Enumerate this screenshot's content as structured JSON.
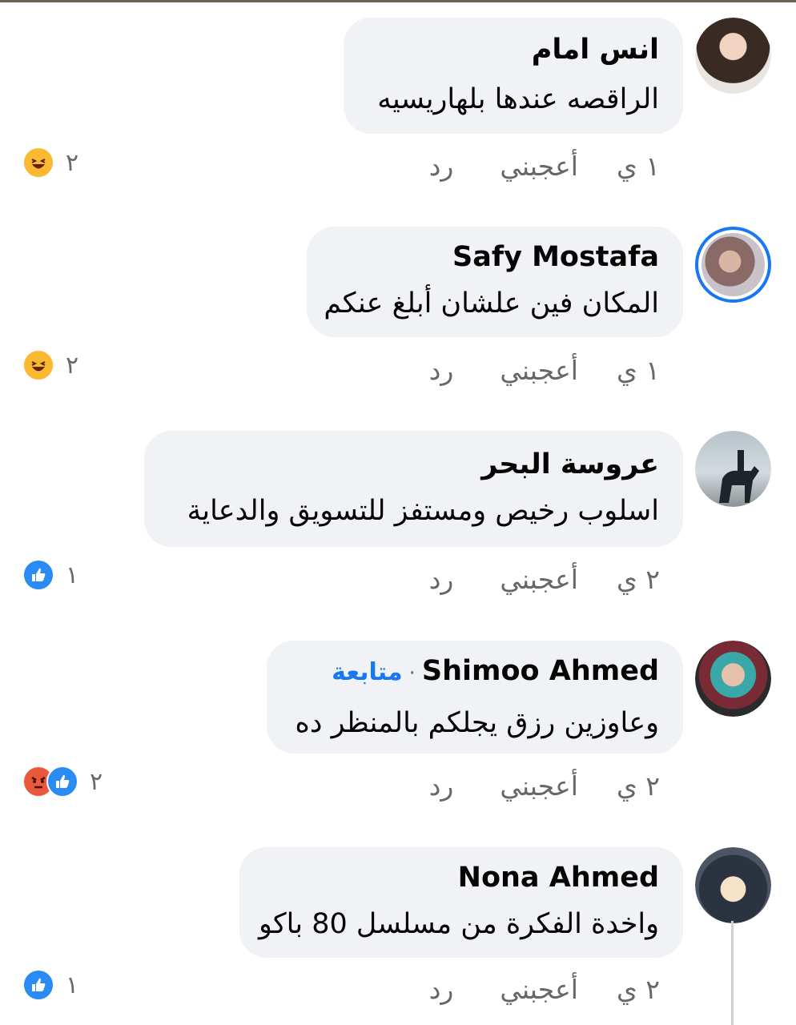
{
  "comments": [
    {
      "author": "انس امام",
      "text": "الراقصه عندها بلهاريسيه",
      "time": "١ ي",
      "like": "أعجبني",
      "reply": "رد",
      "reaction_count": "٢",
      "reactions": [
        "haha-icon"
      ]
    },
    {
      "author": "Safy Mostafa",
      "text": "المكان فين علشان أبلغ عنكم",
      "time": "١ ي",
      "like": "أعجبني",
      "reply": "رد",
      "reaction_count": "٢",
      "reactions": [
        "haha-icon"
      ]
    },
    {
      "author": "عروسة البحر",
      "text": "اسلوب رخيص ومستفز للتسويق والدعاية",
      "time": "٢ ي",
      "like": "أعجبني",
      "reply": "رد",
      "reaction_count": "١",
      "reactions": [
        "like-icon"
      ]
    },
    {
      "author": "Shimoo Ahmed",
      "follow": "متابعة",
      "separator": "·",
      "text": "وعاوزين رزق يجلكم بالمنظر ده",
      "time": "٢ ي",
      "like": "أعجبني",
      "reply": "رد",
      "reaction_count": "٢",
      "reactions": [
        "angry-icon",
        "like-icon"
      ]
    },
    {
      "author": "Nona Ahmed",
      "text": "واخدة الفكرة من مسلسل 80 باكو",
      "time": "٢ ي",
      "like": "أعجبني",
      "reply": "رد",
      "reaction_count": "١",
      "reactions": [
        "like-icon"
      ]
    }
  ],
  "colors": {
    "bubble": "#f0f2f5",
    "link": "#1877f2",
    "meta": "#65676b",
    "haha": "#fbb933",
    "angry": "#e9583a",
    "like": "#2a8bf2"
  }
}
